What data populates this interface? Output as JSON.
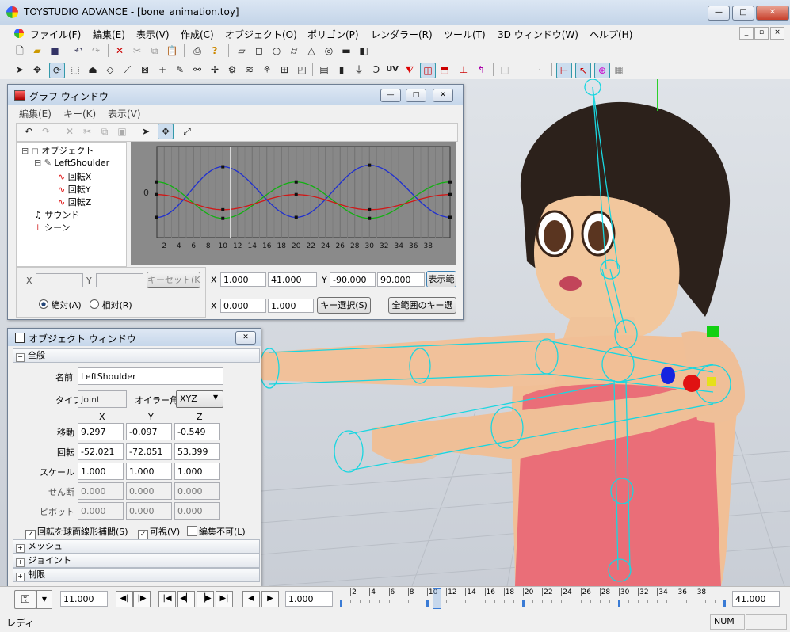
{
  "app": {
    "title": "TOYSTUDIO ADVANCE - [bone_animation.toy]",
    "minimize": "—",
    "maximize": "□",
    "close": "✕"
  },
  "menu": [
    "ファイル(F)",
    "編集(E)",
    "表示(V)",
    "作成(C)",
    "オブジェクト(O)",
    "ポリゴン(P)",
    "レンダラー(R)",
    "ツール(T)",
    "3D ウィンドウ(W)",
    "ヘルプ(H)"
  ],
  "toolbar": {
    "uv_label": "UV"
  },
  "graph_window": {
    "title": "グラフ ウィンドウ",
    "menu": [
      "編集(E)",
      "キー(K)",
      "表示(V)"
    ],
    "tree": {
      "object": "オブジェクト",
      "joint": "LeftShoulder",
      "channels": [
        "回転X",
        "回転Y",
        "回転Z"
      ],
      "sound": "サウンド",
      "scene": "シーン"
    },
    "y_zero_label": "0",
    "x_ticks": [
      "2",
      "4",
      "6",
      "8",
      "10",
      "12",
      "14",
      "16",
      "18",
      "20",
      "22",
      "24",
      "26",
      "28",
      "30",
      "32",
      "34",
      "36",
      "38"
    ],
    "x_label": "X",
    "y_label": "Y",
    "x_value": "",
    "y_value": "",
    "key_set": "キーセット(K)",
    "absolute": "絶対(A)",
    "relative": "相対(R)",
    "range_x_label": "X",
    "range_x_min": "1.000",
    "range_x_max": "41.000",
    "range_y_label": "Y",
    "range_y_min": "-90.000",
    "range_y_max": "90.000",
    "show_range": "表示範",
    "row2_x_label": "X",
    "row2_x_a": "0.000",
    "row2_x_b": "1.000",
    "key_select": "キー選択(S)",
    "all_range_key_select": "全範囲のキー選"
  },
  "chart_data": {
    "type": "line",
    "xlim": [
      1,
      41
    ],
    "ylim": [
      -90,
      90
    ],
    "grid": true,
    "series": [
      {
        "color": "#1f2fd0",
        "x": [
          1,
          10,
          20,
          30,
          41
        ],
        "y": [
          -50,
          50,
          -50,
          53,
          -50
        ]
      },
      {
        "color": "#12b012",
        "x": [
          1,
          10,
          20,
          30,
          41
        ],
        "y": [
          20,
          -52,
          20,
          -52,
          20
        ]
      },
      {
        "color": "#d01818",
        "x": [
          1,
          10,
          20,
          30,
          41
        ],
        "y": [
          -5,
          -35,
          -5,
          -35,
          -5
        ]
      }
    ],
    "current_frame": 11
  },
  "object_window": {
    "title": "オブジェクト ウィンドウ",
    "section_general": "全般",
    "name_label": "名前",
    "name_value": "LeftShoulder",
    "type_label": "タイプ",
    "type_value": "Joint",
    "euler_label": "オイラー角",
    "euler_value": "XYZ",
    "col_x": "X",
    "col_y": "Y",
    "col_z": "Z",
    "rows": [
      {
        "label": "移動",
        "x": "9.297",
        "y": "-0.097",
        "z": "-0.549",
        "enabled": true
      },
      {
        "label": "回転",
        "x": "-52.021",
        "y": "-72.051",
        "z": "53.399",
        "enabled": true
      },
      {
        "label": "スケール",
        "x": "1.000",
        "y": "1.000",
        "z": "1.000",
        "enabled": true
      },
      {
        "label": "せん断",
        "x": "0.000",
        "y": "0.000",
        "z": "0.000",
        "enabled": false
      },
      {
        "label": "ピボット",
        "x": "0.000",
        "y": "0.000",
        "z": "0.000",
        "enabled": false
      }
    ],
    "chk_slerp": "回転を球面線形補間(S)",
    "chk_visible": "可視(V)",
    "chk_locked": "編集不可(L)",
    "section_mesh": "メッシュ",
    "section_joint": "ジョイント",
    "section_limit": "制限"
  },
  "timeline": {
    "current_frame": "11.000",
    "start": "1.000",
    "end": "41.000",
    "ticks": [
      "2",
      "4",
      "6",
      "8",
      "10",
      "12",
      "14",
      "16",
      "18",
      "20",
      "22",
      "24",
      "26",
      "28",
      "30",
      "32",
      "34",
      "36",
      "38"
    ]
  },
  "status": {
    "text": "レディ",
    "num": "NUM"
  }
}
